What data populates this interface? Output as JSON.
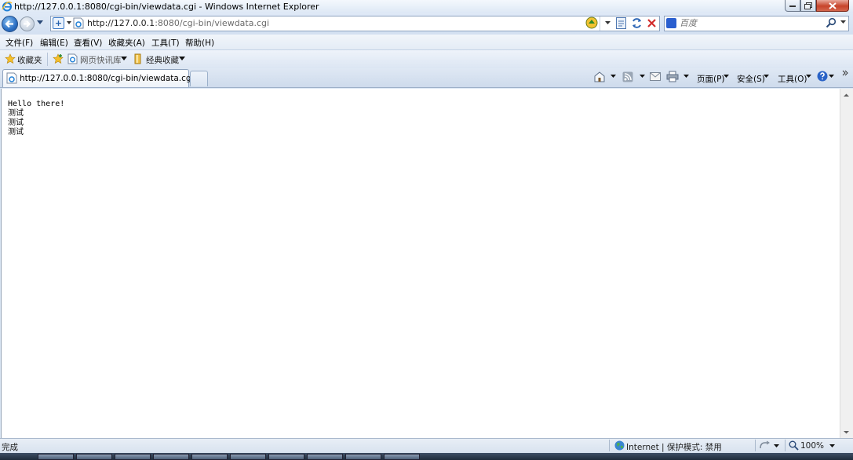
{
  "window": {
    "title": "http://127.0.0.1:8080/cgi-bin/viewdata.cgi - Windows Internet Explorer"
  },
  "address_bar": {
    "url_host": "http://127.0.0.1",
    "url_rest": ":8080/cgi-bin/viewdata.cgi"
  },
  "search": {
    "placeholder": "百度"
  },
  "menu": {
    "items": [
      "文件(F)",
      "编辑(E)",
      "查看(V)",
      "收藏夹(A)",
      "工具(T)",
      "帮助(H)"
    ]
  },
  "favorites_bar": {
    "favorites_label": "收藏夹",
    "web_slice_label": "网页快讯库",
    "classic_favorites_label": "经典收藏"
  },
  "tab": {
    "title": "http://127.0.0.1:8080/cgi-bin/viewdata.cgi"
  },
  "command_bar": {
    "page_label": "页面(P)",
    "safety_label": "安全(S)",
    "tools_label": "工具(O)"
  },
  "page": {
    "lines": [
      "Hello there!",
      "测试",
      "测试",
      "测试"
    ]
  },
  "status_bar": {
    "status": "完成",
    "zone": "Internet | 保护模式: 禁用",
    "zoom": "100%"
  },
  "colors": {
    "chrome_bg": "#dbe6f4",
    "close_button": "#c7442b",
    "content_bg": "#ffffff"
  }
}
